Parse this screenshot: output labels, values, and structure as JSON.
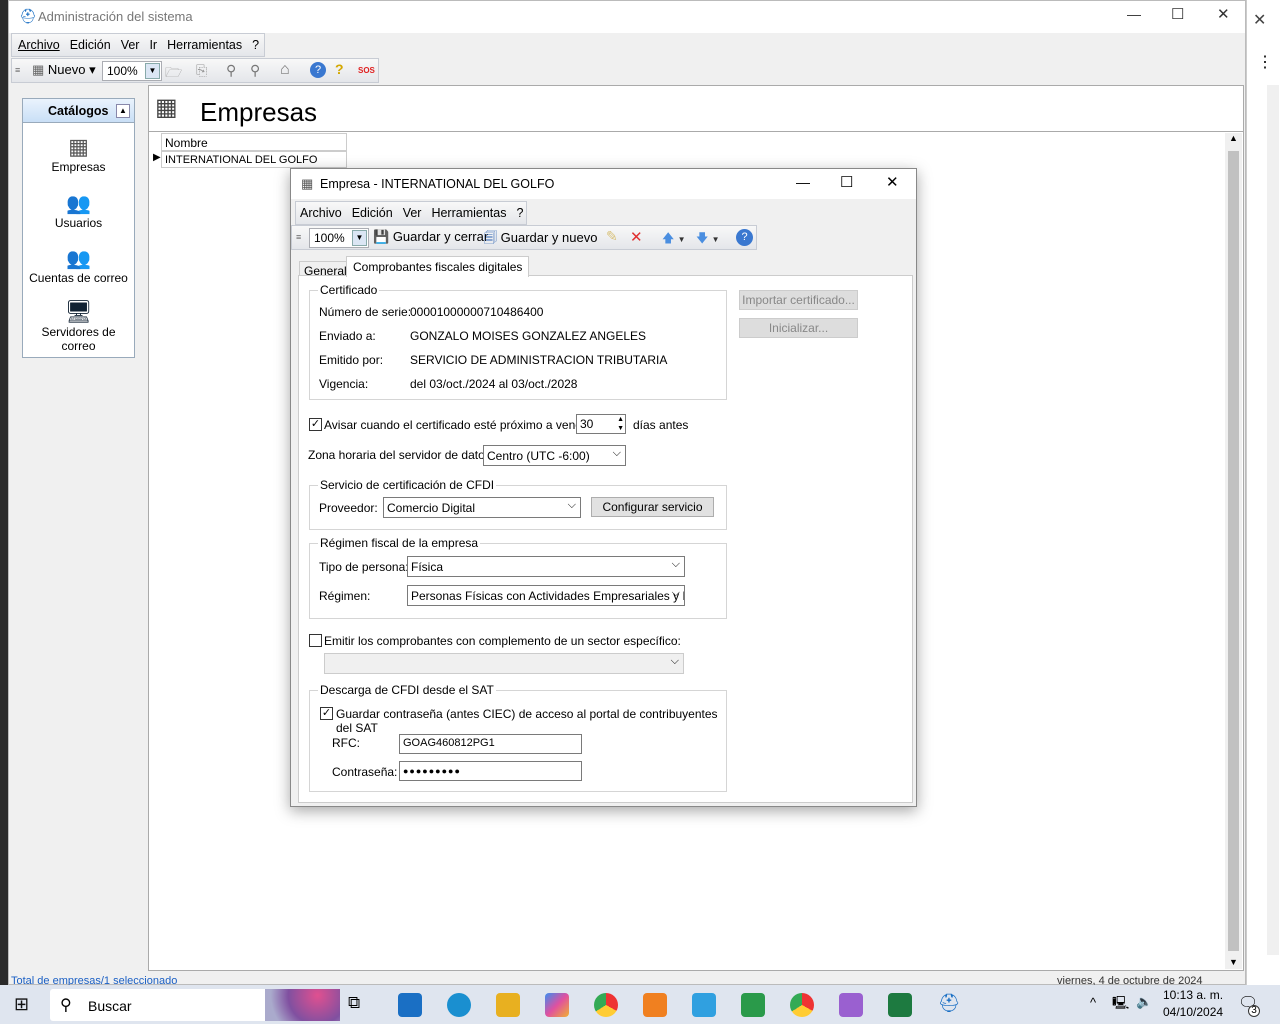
{
  "main": {
    "title": "Administración del sistema",
    "menu": [
      "Archivo",
      "Edición",
      "Ver",
      "Ir",
      "Herramientas",
      "?"
    ],
    "toolbar": {
      "new_label": "Nuevo",
      "zoom": "100%",
      "sos": "SOS"
    },
    "catalog": {
      "title": "Catálogos",
      "items": [
        "Empresas",
        "Usuarios",
        "Cuentas de correo",
        "Servidores de correo"
      ]
    },
    "page_title": "Empresas",
    "grid": {
      "column": "Nombre",
      "rows": [
        "INTERNATIONAL DEL GOLFO"
      ]
    },
    "status": {
      "left": "Total de empresas/1 seleccionado",
      "right": "viernes, 4 de octubre de 2024"
    }
  },
  "dialog": {
    "title": "Empresa - INTERNATIONAL DEL GOLFO",
    "menu": [
      "Archivo",
      "Edición",
      "Ver",
      "Herramientas",
      "?"
    ],
    "toolbar": {
      "zoom": "100%",
      "save_close": "Guardar y cerrar",
      "save_new": "Guardar y nuevo"
    },
    "tabs": [
      "General",
      "Comprobantes fiscales digitales"
    ],
    "cert": {
      "legend": "Certificado",
      "serial_label": "Número de serie:",
      "serial": "00001000000710486400",
      "sent_label": "Enviado a:",
      "sent": "GONZALO MOISES GONZALEZ ANGELES",
      "issuer_label": "Emitido por:",
      "issuer": "SERVICIO DE ADMINISTRACION TRIBUTARIA",
      "validity_label": "Vigencia:",
      "validity": "del 03/oct./2024 al 03/oct./2028",
      "import_btn": "Importar certificado...",
      "init_btn": "Inicializar..."
    },
    "warn": {
      "label": "Avisar cuando el certificado esté próximo a vencer:",
      "days": "30",
      "suffix": "días antes",
      "checked": true
    },
    "tz": {
      "label": "Zona horaria del servidor de datos:",
      "value": "Centro (UTC -6:00)"
    },
    "pac": {
      "legend": "Servicio de certificación de CFDI",
      "provider_label": "Proveedor:",
      "provider": "Comercio Digital",
      "config_btn": "Configurar servicio"
    },
    "regime": {
      "legend": "Régimen fiscal  de la empresa",
      "person_label": "Tipo de persona:",
      "person": "Física",
      "regime_label": "Régimen:",
      "regime": "Personas Físicas con Actividades Empresariales y Pro"
    },
    "complement": {
      "label": "Emitir los comprobantes con complemento de un sector específico:",
      "checked": false,
      "value": ""
    },
    "sat": {
      "legend": "Descarga de CFDI desde el SAT",
      "save_label": "Guardar contraseña (antes CIEC) de acceso al portal de contribuyentes del SAT",
      "checked": true,
      "rfc_label": "RFC:",
      "rfc": "GOAG460812PG1",
      "pwd_label": "Contraseña:",
      "pwd": "●●●●●●●●●"
    }
  },
  "taskbar": {
    "search": "Buscar",
    "time": "10:13 a. m.",
    "date": "04/10/2024",
    "notifications": "3"
  }
}
